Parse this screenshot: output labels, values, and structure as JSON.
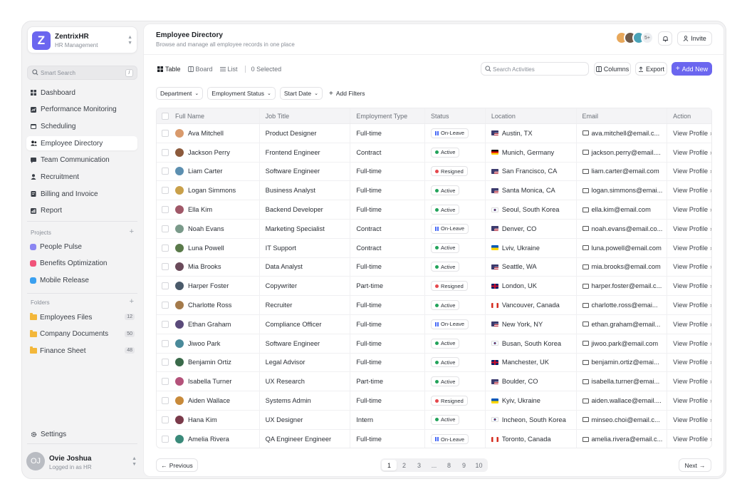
{
  "brand": {
    "name": "ZentrixHR",
    "subtitle": "HR Management",
    "logo_letter": "Z",
    "color": "#6b66ef"
  },
  "sidebar": {
    "search_placeholder": "Smart Search",
    "search_shortcut": "/",
    "nav": [
      {
        "label": "Dashboard",
        "icon": "grid-icon"
      },
      {
        "label": "Performance Monitoring",
        "icon": "chart-icon"
      },
      {
        "label": "Scheduling",
        "icon": "calendar-icon"
      },
      {
        "label": "Employee Directory",
        "icon": "users-icon",
        "active": true
      },
      {
        "label": "Team Communication",
        "icon": "chat-icon"
      },
      {
        "label": "Recruitment",
        "icon": "user-icon"
      },
      {
        "label": "Billing and Invoice",
        "icon": "invoice-icon"
      },
      {
        "label": "Report",
        "icon": "report-icon"
      }
    ],
    "projects_label": "Projects",
    "projects": [
      {
        "label": "People Pulse",
        "color": "#8b86f2"
      },
      {
        "label": "Benefits Optimization",
        "color": "#f0547a"
      },
      {
        "label": "Mobile Release",
        "color": "#3aa0f0"
      }
    ],
    "folders_label": "Folders",
    "folders": [
      {
        "label": "Employees Files",
        "count": "12"
      },
      {
        "label": "Company Documents",
        "count": "50"
      },
      {
        "label": "Finance Sheet",
        "count": "48"
      }
    ],
    "settings_label": "Settings",
    "user": {
      "name": "Ovie Joshua",
      "status": "Logged in as HR",
      "initials": "OJ"
    }
  },
  "header": {
    "title": "Employee Directory",
    "subtitle": "Browse and manage all employee records in one place",
    "avatar_more": "5+",
    "invite_label": "Invite"
  },
  "toolbar": {
    "views": [
      {
        "label": "Table",
        "active": true
      },
      {
        "label": "Board"
      },
      {
        "label": "List"
      }
    ],
    "selected": "0 Selected",
    "search_placeholder": "Search Activities",
    "columns_label": "Columns",
    "export_label": "Export",
    "add_label": "Add New"
  },
  "filters": [
    "Department",
    "Employment Status",
    "Start Date"
  ],
  "add_filters_label": "Add Filters",
  "table": {
    "columns": [
      "Full Name",
      "Job Title",
      "Employment Type",
      "Status",
      "Location",
      "Email",
      "Action"
    ],
    "action_label": "View Profile",
    "rows": [
      {
        "name": "Ava Mitchell",
        "job": "Product Designer",
        "type": "Full-time",
        "status": "On-Leave",
        "flag": "us",
        "location": "Austin, TX",
        "email": "ava.mitchell@email.c..."
      },
      {
        "name": "Jackson Perry",
        "job": "Frontend Engineer",
        "type": "Contract",
        "status": "Active",
        "flag": "de",
        "location": "Munich, Germany",
        "email": "jackson.perry@email...."
      },
      {
        "name": "Liam Carter",
        "job": "Software Engineer",
        "type": "Full-time",
        "status": "Resigned",
        "flag": "us",
        "location": "San Francisco, CA",
        "email": "liam.carter@email.com"
      },
      {
        "name": "Logan Simmons",
        "job": "Business Analyst",
        "type": "Full-time",
        "status": "Active",
        "flag": "us",
        "location": "Santa Monica, CA",
        "email": "logan.simmons@emai..."
      },
      {
        "name": "Ella Kim",
        "job": "Backend Developer",
        "type": "Full-time",
        "status": "Active",
        "flag": "kr",
        "location": "Seoul, South Korea",
        "email": "ella.kim@email.com"
      },
      {
        "name": "Noah Evans",
        "job": "Marketing Specialist",
        "type": "Contract",
        "status": "On-Leave",
        "flag": "us",
        "location": "Denver, CO",
        "email": "noah.evans@email.co..."
      },
      {
        "name": "Luna Powell",
        "job": "IT Support",
        "type": "Contract",
        "status": "Active",
        "flag": "ua",
        "location": "Lviv, Ukraine",
        "email": "luna.powell@email.com"
      },
      {
        "name": "Mia Brooks",
        "job": "Data Analyst",
        "type": "Full-time",
        "status": "Active",
        "flag": "us",
        "location": "Seattle, WA",
        "email": "mia.brooks@email.com"
      },
      {
        "name": "Harper Foster",
        "job": "Copywriter",
        "type": "Part-time",
        "status": "Resigned",
        "flag": "uk",
        "location": "London, UK",
        "email": "harper.foster@email.c..."
      },
      {
        "name": "Charlotte Ross",
        "job": "Recruiter",
        "type": "Full-time",
        "status": "Active",
        "flag": "ca",
        "location": "Vancouver, Canada",
        "email": "charlotte.ross@emai..."
      },
      {
        "name": "Ethan Graham",
        "job": "Compliance Officer",
        "type": "Full-time",
        "status": "On-Leave",
        "flag": "us",
        "location": "New York, NY",
        "email": "ethan.graham@email..."
      },
      {
        "name": "Jiwoo Park",
        "job": "Software Engineer",
        "type": "Full-time",
        "status": "Active",
        "flag": "kr",
        "location": "Busan, South Korea",
        "email": "jiwoo.park@email.com"
      },
      {
        "name": "Benjamin Ortiz",
        "job": "Legal Advisor",
        "type": "Full-time",
        "status": "Active",
        "flag": "uk",
        "location": "Manchester, UK",
        "email": "benjamin.ortiz@emai..."
      },
      {
        "name": "Isabella Turner",
        "job": "UX Research",
        "type": "Part-time",
        "status": "Active",
        "flag": "us",
        "location": "Boulder, CO",
        "email": "isabella.turner@emai..."
      },
      {
        "name": "Aiden Wallace",
        "job": "Systems Admin",
        "type": "Full-time",
        "status": "Resigned",
        "flag": "ua",
        "location": "Kyiv, Ukraine",
        "email": "aiden.wallace@email...."
      },
      {
        "name": "Hana Kim",
        "job": "UX Designer",
        "type": "Intern",
        "status": "Active",
        "flag": "kr",
        "location": "Incheon, South Korea",
        "email": "minseo.choi@email.c..."
      },
      {
        "name": "Amelia Rivera",
        "job": "QA Engineer Engineer",
        "type": "Full-time",
        "status": "On-Leave",
        "flag": "ca",
        "location": "Toronto, Canada",
        "email": "amelia.rivera@email.c..."
      }
    ]
  },
  "pagination": {
    "prev_label": "Previous",
    "next_label": "Next",
    "pages": [
      "1",
      "2",
      "3",
      "...",
      "8",
      "9",
      "10"
    ],
    "current": "1"
  },
  "colors": {
    "accent": "#6b66ef",
    "active": "#22a35a",
    "resigned": "#e5484d",
    "on_leave": "#4a6cf7"
  }
}
